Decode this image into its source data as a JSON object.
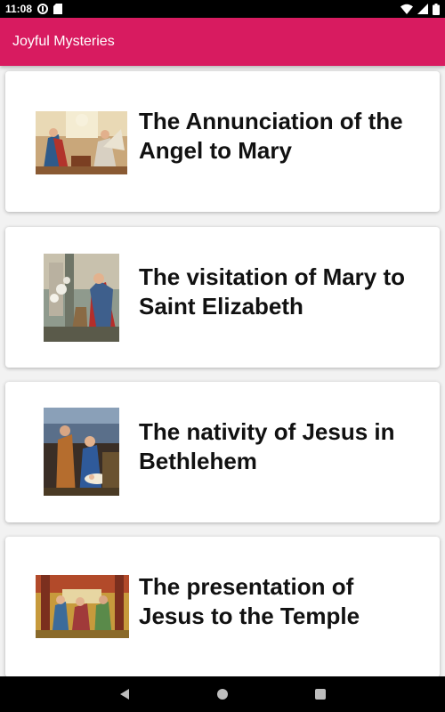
{
  "status_bar": {
    "time": "11:08",
    "icons": [
      "data-saver-icon",
      "sd-card-icon",
      "wifi-icon",
      "signal-icon",
      "battery-icon"
    ]
  },
  "app_bar": {
    "title": "Joyful Mysteries",
    "color": "#d81b60"
  },
  "mysteries": [
    {
      "title": "The Annunciation of the Angel to Mary",
      "image": "annunciation-painting"
    },
    {
      "title": "The visitation of Mary to Saint Elizabeth",
      "image": "visitation-painting"
    },
    {
      "title": "The nativity of Jesus in Bethlehem",
      "image": "nativity-painting"
    },
    {
      "title": "The presentation of Jesus to the Temple",
      "image": "presentation-painting"
    }
  ],
  "nav_bar": {
    "buttons": [
      "back-icon",
      "home-icon",
      "recents-icon"
    ]
  }
}
